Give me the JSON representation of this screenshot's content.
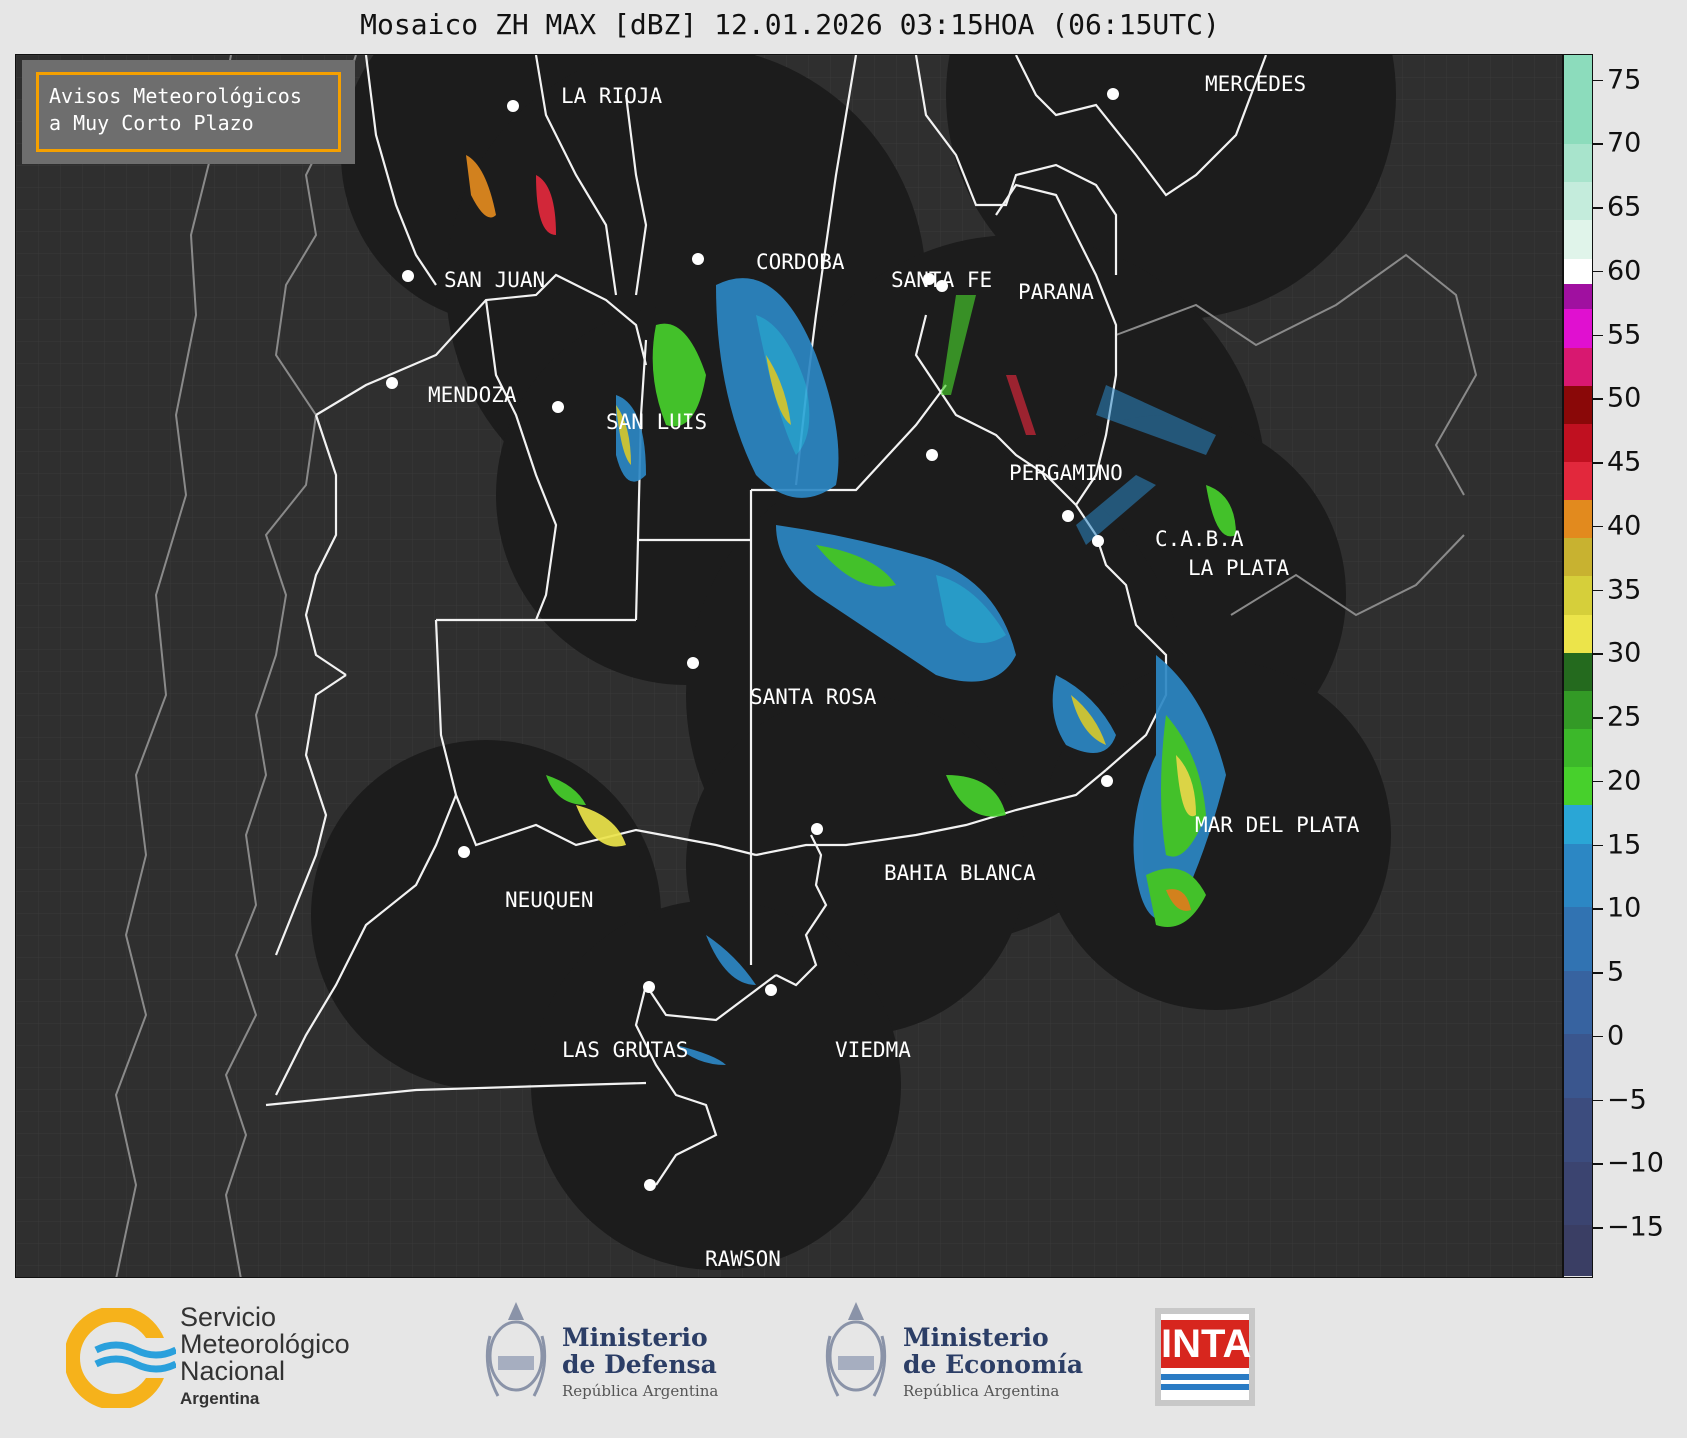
{
  "title": "Mosaico ZH MAX [dBZ] 12.01.2026 03:15HOA (06:15UTC)",
  "avisos": {
    "line1": "Avisos Meteorológicos",
    "line2": "a Muy Corto Plazo"
  },
  "cities": [
    {
      "name": "LA RIOJA"
    },
    {
      "name": "MERCEDES"
    },
    {
      "name": "CORDOBA"
    },
    {
      "name": "SAN JUAN"
    },
    {
      "name": "SANTA FE"
    },
    {
      "name": "PARANA"
    },
    {
      "name": "MENDOZA"
    },
    {
      "name": "SAN LUIS"
    },
    {
      "name": "PERGAMINO"
    },
    {
      "name": "C.A.B.A"
    },
    {
      "name": "LA PLATA"
    },
    {
      "name": "SANTA ROSA"
    },
    {
      "name": "MAR DEL PLATA"
    },
    {
      "name": "BAHIA BLANCA"
    },
    {
      "name": "NEUQUEN"
    },
    {
      "name": "LAS GRUTAS"
    },
    {
      "name": "VIEDMA"
    },
    {
      "name": "RAWSON"
    }
  ],
  "colorbar": {
    "min": -19,
    "max": 77,
    "tick_labels": [
      "75",
      "70",
      "65",
      "60",
      "55",
      "50",
      "45",
      "40",
      "35",
      "30",
      "25",
      "20",
      "15",
      "10",
      "5",
      "0",
      "−5",
      "−10",
      "−15"
    ],
    "tick_values": [
      75,
      70,
      65,
      60,
      55,
      50,
      45,
      40,
      35,
      30,
      25,
      20,
      15,
      10,
      5,
      0,
      -5,
      -10,
      -15
    ],
    "bands": [
      {
        "from": -19,
        "to": -15,
        "color": "#3a3e64"
      },
      {
        "from": -15,
        "to": -10,
        "color": "#3b4470"
      },
      {
        "from": -10,
        "to": -5,
        "color": "#3c4c7e"
      },
      {
        "from": -5,
        "to": 0,
        "color": "#3a568e"
      },
      {
        "from": 0,
        "to": 5,
        "color": "#3763a0"
      },
      {
        "from": 5,
        "to": 10,
        "color": "#3173b2"
      },
      {
        "from": 10,
        "to": 15,
        "color": "#2c87c4"
      },
      {
        "from": 15,
        "to": 18,
        "color": "#2aa6d6"
      },
      {
        "from": 18,
        "to": 21,
        "color": "#47d02c"
      },
      {
        "from": 21,
        "to": 24,
        "color": "#3cb82a"
      },
      {
        "from": 24,
        "to": 27,
        "color": "#339a26"
      },
      {
        "from": 27,
        "to": 30,
        "color": "#246a1e"
      },
      {
        "from": 30,
        "to": 33,
        "color": "#ece44a"
      },
      {
        "from": 33,
        "to": 36,
        "color": "#d6cf3a"
      },
      {
        "from": 36,
        "to": 39,
        "color": "#c8b230"
      },
      {
        "from": 39,
        "to": 42,
        "color": "#e28a1e"
      },
      {
        "from": 42,
        "to": 45,
        "color": "#e2283c"
      },
      {
        "from": 45,
        "to": 48,
        "color": "#c01020"
      },
      {
        "from": 48,
        "to": 51,
        "color": "#8a0808"
      },
      {
        "from": 51,
        "to": 54,
        "color": "#d81870"
      },
      {
        "from": 54,
        "to": 57,
        "color": "#e010d0"
      },
      {
        "from": 57,
        "to": 59,
        "color": "#a010a0"
      },
      {
        "from": 59,
        "to": 61,
        "color": "#ffffff"
      },
      {
        "from": 61,
        "to": 64,
        "color": "#e0f4ea"
      },
      {
        "from": 64,
        "to": 67,
        "color": "#c4ecdc"
      },
      {
        "from": 67,
        "to": 70,
        "color": "#a8e4cc"
      },
      {
        "from": 70,
        "to": 77,
        "color": "#8cdcbc"
      }
    ]
  },
  "logos": {
    "smn": {
      "line1": "Servicio",
      "line2": "Meteorológico",
      "line3": "Nacional",
      "line4": "Argentina"
    },
    "defensa": {
      "line1": "Ministerio",
      "line2": "de Defensa",
      "line3": "República Argentina"
    },
    "economia": {
      "line1": "Ministerio",
      "line2": "de Economía",
      "line3": "República Argentina"
    },
    "inta": {
      "word": "INTA"
    }
  }
}
